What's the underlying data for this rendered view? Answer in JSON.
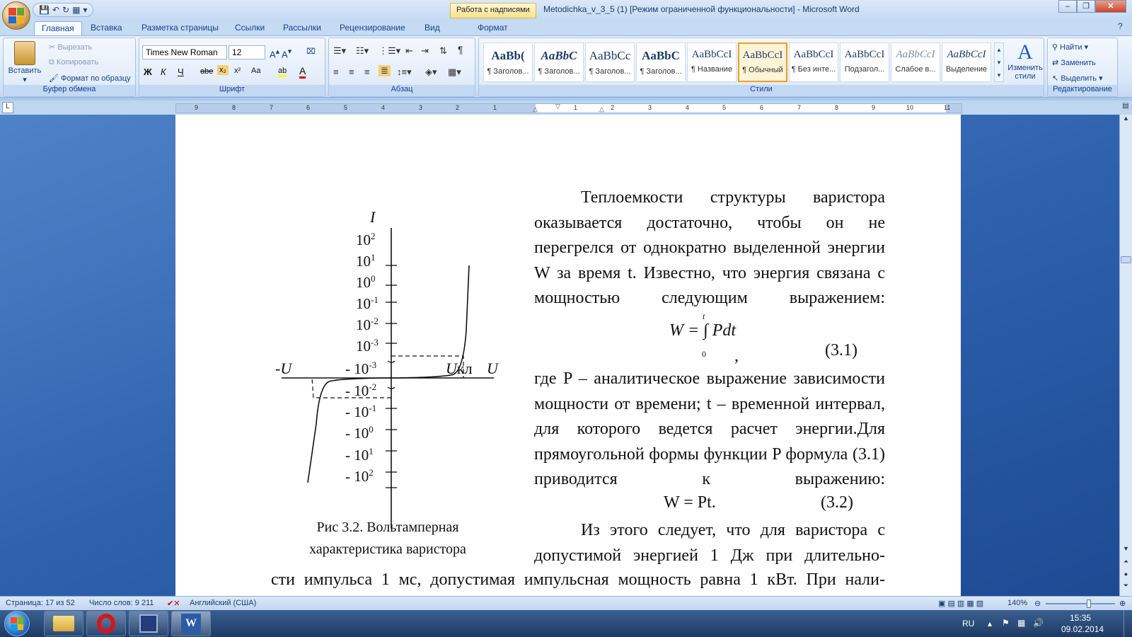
{
  "window": {
    "title": "Metodichka_v_3_5 (1) [Режим ограниченной функциональности] - Microsoft Word",
    "context_tab": "Работа с надписями"
  },
  "tabs": [
    "Главная",
    "Вставка",
    "Разметка страницы",
    "Ссылки",
    "Рассылки",
    "Рецензирование",
    "Вид",
    "Формат"
  ],
  "clipboard": {
    "paste": "Вставить",
    "cut": "Вырезать",
    "copy": "Копировать",
    "format_painter": "Формат по образцу",
    "label": "Буфер обмена"
  },
  "font": {
    "name": "Times New Roman",
    "size": "12",
    "label": "Шрифт",
    "bold": "Ж",
    "italic": "К",
    "underline": "Ч",
    "strike": "abe",
    "sub": "x₂",
    "sup": "x²",
    "case": "Aa"
  },
  "paragraph": {
    "label": "Абзац"
  },
  "styles": {
    "label": "Стили",
    "items": [
      "¶ Заголов...",
      "¶ Заголов...",
      "¶ Заголов...",
      "¶ Заголов...",
      "¶ Название",
      "¶ Обычный",
      "¶ Без инте...",
      "Подзагол...",
      "Слабое в...",
      "Выделение"
    ],
    "samples": [
      "AaBb(",
      "AaBbC",
      "AaBbCc",
      "AaBbC",
      "AaBbCcI",
      "AaBbCcI",
      "AaBbCcI",
      "AaBbCcI",
      "AaBbCcI",
      "AaBbCcI"
    ],
    "change": "Изменить стили"
  },
  "editing": {
    "find": "Найти",
    "replace": "Заменить",
    "select": "Выделить",
    "label": "Редактирование"
  },
  "ruler": {
    "numbers": [
      "9",
      "8",
      "7",
      "6",
      "5",
      "4",
      "3",
      "2",
      "1",
      "1",
      "2",
      "3",
      "4",
      "5",
      "6",
      "7",
      "8",
      "9",
      "10",
      "11"
    ]
  },
  "document": {
    "para1": "Теплоемкости структуры варистора оказывается достаточно, чтобы он не перегрелся от однократно выделенной энергии W за время t. Известно, что энергия связана с мощностью следующим выражением:",
    "formula1": "W = ∫ Pdt",
    "formula1_upper": "t",
    "formula1_lower": "0",
    "formula1_comma": ",",
    "formula1_num": "(3.1)",
    "para2": "где P – аналитическое выражение зависимости мощности от времени; t – временной интервал, для которого ведется расчет энергии.Для прямоугольной формы функции P формула (3.1) приводится к выражению:",
    "formula2": "W = Pt.",
    "formula2_num": "(3.2)",
    "para3": "Из этого следует, что для варистора с допустимой энергией 1 Дж при длительно-",
    "para4": "сти импульса 1 мс, допустимая импульсная мощность равна 1 кВт. При нали-",
    "caption_line1": "Рис 3.2. Вольтамперная",
    "caption_line2": "характеристика варистора",
    "figure": {
      "y_axis": "I",
      "x_axis": "U",
      "neg_x": "-U",
      "ukl": "Uкл",
      "pos_ticks": [
        "10^2",
        "10^1",
        "10^0",
        "10^-1",
        "10^-2",
        "10^-3"
      ],
      "neg_ticks": [
        "- 10^-3",
        "- 10^-2",
        "- 10^-1",
        "- 10^0",
        "- 10^1",
        "- 10^2"
      ]
    }
  },
  "status": {
    "page": "Страница: 17 из 52",
    "words": "Число слов: 9 211",
    "lang": "Английский (США)",
    "zoom": "140%"
  },
  "tray": {
    "lang": "RU",
    "time": "15:35",
    "date": "09.02.2014"
  }
}
